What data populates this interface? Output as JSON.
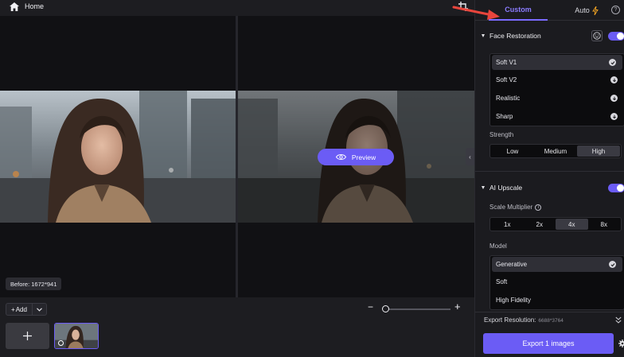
{
  "header": {
    "home_label": "Home"
  },
  "canvas": {
    "preview_label": "Preview",
    "before_label": "Before: 1672*941"
  },
  "bottom": {
    "add_label": "Add",
    "add_plus": "+",
    "add_tile_plus": "+"
  },
  "panel": {
    "tabs": {
      "custom": "Custom",
      "auto": "Auto"
    },
    "help": "?",
    "face_restoration": {
      "title": "Face Restoration",
      "enabled": true,
      "options": [
        {
          "label": "Soft V1",
          "state": "selected"
        },
        {
          "label": "Soft V2",
          "state": "download"
        },
        {
          "label": "Realistic",
          "state": "download"
        },
        {
          "label": "Sharp",
          "state": "download"
        }
      ],
      "strength_label": "Strength",
      "strength_options": [
        "Low",
        "Medium",
        "High"
      ],
      "strength_selected": "High"
    },
    "ai_upscale": {
      "title": "AI Upscale",
      "enabled": true,
      "scale_label": "Scale Multiplier",
      "info": "i",
      "scale_options": [
        "1x",
        "2x",
        "4x",
        "8x"
      ],
      "scale_selected": "4x",
      "model_label": "Model",
      "models": [
        {
          "label": "Generative",
          "state": "selected"
        },
        {
          "label": "Soft",
          "state": "none"
        },
        {
          "label": "High Fidelity",
          "state": "none"
        }
      ]
    },
    "export_resolution_label": "Export Resolution:",
    "export_resolution_value": "6688*3764",
    "export_button": "Export 1 images"
  },
  "colors": {
    "accent": "#6b5cf5",
    "accent_text": "#8b7cff",
    "annotation": "#e8453c"
  }
}
